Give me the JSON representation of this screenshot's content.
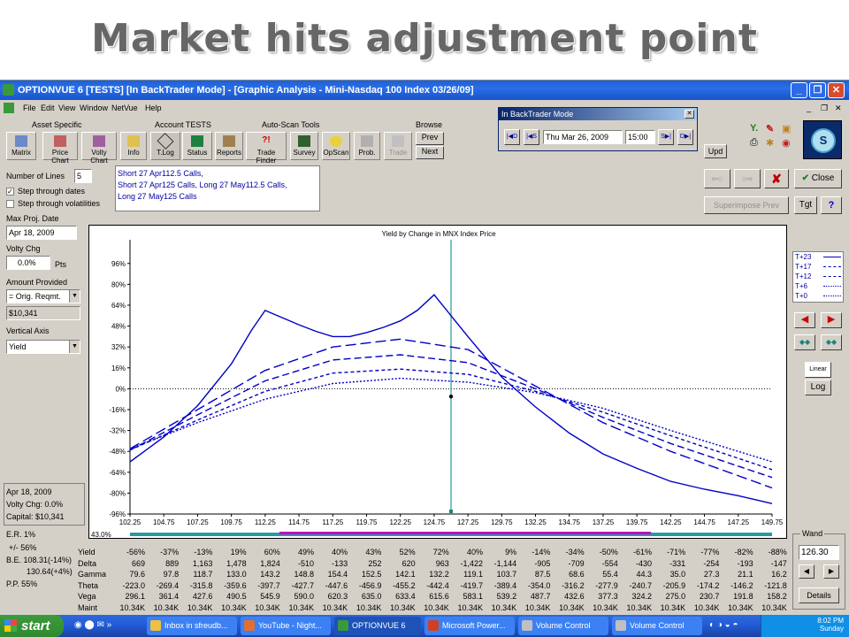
{
  "slide_title": "Market hits adjustment point",
  "window": {
    "title": "OPTIONVUE 6   [TESTS]  [In BackTrader Mode] - [Graphic Analysis - Mini-Nasdaq 100 Index  03/26/09]"
  },
  "menu": [
    "File",
    "Edit",
    "View",
    "Window",
    "NetVue",
    "Help"
  ],
  "groups": {
    "asset_specific": "Asset Specific",
    "account": "Account TESTS",
    "autoscan": "Auto-Scan Tools",
    "browse": "Browse"
  },
  "tools": [
    "Matrix",
    "Price Chart",
    "Volty Chart",
    "Info",
    "T.Log",
    "Status",
    "Reports",
    "Trade Finder",
    "Survey",
    "OpScan",
    "Prob.",
    "Trade"
  ],
  "browse": {
    "prev": "Prev",
    "next": "Next"
  },
  "backtrader": {
    "title": "In BackTrader Mode",
    "date": "Thu Mar 26, 2009",
    "time": "15:00",
    "btn_d_left": "D",
    "btn_s_left": "S",
    "btn_s_right": "S",
    "btn_d_right": "D"
  },
  "upd": "Upd",
  "left_panel": {
    "num_lines_label": "Number of Lines",
    "num_lines": "5",
    "step_dates": "Step through dates",
    "step_vols": "Step through volatilities",
    "max_proj_label": "Max Proj. Date",
    "max_proj": "Apr 18, 2009",
    "volty_label": "Volty Chg",
    "volty": "0.0%",
    "volty_unit": "Pts",
    "amount_label": "Amount Provided",
    "amount_select": "= Orig. Reqmt.",
    "amount_value": "$10,341",
    "vertical_label": "Vertical Axis",
    "vertical_select": "Yield",
    "info_date": "Apr 18, 2009",
    "info_volty": "Volty Chg:  0.0%",
    "info_capital": "Capital:  $10,341"
  },
  "positions": [
    "Short 27 Apr112.5 Calls,",
    "Short 27 Apr125 Calls, Long 27 May112.5 Calls,",
    "Long 27 May125 Calls"
  ],
  "right_buttons": {
    "close": "Close",
    "superimpose": "Superimpose Prev",
    "tgt": "Tgt",
    "help": "?",
    "linear": "Linear",
    "log": "Log"
  },
  "legend": [
    {
      "label": "T+23",
      "style": "solid"
    },
    {
      "label": "T+17",
      "style": "longdash"
    },
    {
      "label": "T+12",
      "style": "dash"
    },
    {
      "label": "T+6",
      "style": "shortdash"
    },
    {
      "label": "T+0",
      "style": "dot"
    }
  ],
  "chart_data": {
    "type": "line",
    "title": "Yield by Change in MNX Index Price",
    "xlabel": "",
    "ylabel": "",
    "x_ticks": [
      "102.25",
      "104.75",
      "107.25",
      "109.75",
      "112.25",
      "114.75",
      "117.25",
      "119.75",
      "122.25",
      "124.75",
      "127.25",
      "129.75",
      "132.25",
      "134.75",
      "137.25",
      "139.75",
      "142.25",
      "144.75",
      "147.25",
      "149.75"
    ],
    "y_ticks": [
      "96%",
      "80%",
      "64%",
      "48%",
      "32%",
      "16%",
      "0%",
      "-16%",
      "-32%",
      "-48%",
      "-64%",
      "-80%",
      "-96%"
    ],
    "xlim": [
      102.25,
      149.75
    ],
    "ylim": [
      -96,
      106
    ],
    "current_price": 126.0,
    "corner_label": "43.0%",
    "series": [
      {
        "style": "solid",
        "x": [
          102.25,
          104.75,
          107.25,
          109.75,
          111.25,
          112.25,
          114.75,
          116.0,
          117.25,
          118.5,
          119.75,
          121.0,
          122.25,
          123.5,
          124.75,
          127.25,
          129.75,
          132.25,
          134.75,
          137.25,
          139.75,
          142.25,
          144.75,
          147.25,
          149.75
        ],
        "y": [
          -56,
          -37,
          -13,
          19,
          45,
          60,
          49,
          44,
          40,
          40,
          43,
          47,
          52,
          60,
          72,
          40,
          9,
          -14,
          -34,
          -50,
          -61,
          -71,
          -77,
          -82,
          -88
        ]
      },
      {
        "style": "longdash",
        "x": [
          102.25,
          107.25,
          112.25,
          117.25,
          122.25,
          127.25,
          132.25,
          137.25,
          142.25,
          149.75
        ],
        "y": [
          -46,
          -16,
          14,
          32,
          38,
          30,
          2,
          -26,
          -48,
          -76
        ]
      },
      {
        "style": "dash",
        "x": [
          102.25,
          107.25,
          112.25,
          117.25,
          122.25,
          127.25,
          132.25,
          137.25,
          142.25,
          149.75
        ],
        "y": [
          -47,
          -20,
          6,
          22,
          26,
          20,
          0,
          -22,
          -42,
          -68
        ]
      },
      {
        "style": "shortdash",
        "x": [
          102.25,
          107.25,
          112.25,
          117.25,
          122.25,
          127.25,
          132.25,
          137.25,
          142.25,
          149.75
        ],
        "y": [
          -47,
          -24,
          -2,
          12,
          15,
          11,
          -2,
          -18,
          -36,
          -62
        ]
      },
      {
        "style": "dot",
        "x": [
          102.25,
          107.25,
          112.25,
          117.25,
          122.25,
          127.25,
          132.25,
          137.25,
          142.25,
          149.75
        ],
        "y": [
          -46,
          -26,
          -8,
          4,
          8,
          5,
          -3,
          -15,
          -32,
          -56
        ]
      }
    ]
  },
  "table": {
    "pm_label": "+/-   56%",
    "be_label": "B.E.  108.31(-14%)",
    "be2_label": "130.64(+4%)",
    "pp_label": "P.P.  55%",
    "er_label": "E.R.    1%",
    "row_labels": [
      "Yield",
      "Delta",
      "Gamma",
      "Theta",
      "Vega",
      "Maint"
    ],
    "columns": [
      [
        "-56%",
        "669",
        "79.6",
        "-223.0",
        "296.1",
        "10.34K"
      ],
      [
        "-37%",
        "889",
        "97.8",
        "-269.4",
        "361.4",
        "10.34K"
      ],
      [
        "-13%",
        "1,163",
        "118.7",
        "-315.8",
        "427.6",
        "10.34K"
      ],
      [
        "19%",
        "1,478",
        "133.0",
        "-359.6",
        "490.5",
        "10.34K"
      ],
      [
        "60%",
        "1,824",
        "143.2",
        "-397.7",
        "545.9",
        "10.34K"
      ],
      [
        "49%",
        "-510",
        "148.8",
        "-427.7",
        "590.0",
        "10.34K"
      ],
      [
        "40%",
        "-133",
        "154.4",
        "-447.6",
        "620.3",
        "10.34K"
      ],
      [
        "43%",
        "252",
        "152.5",
        "-456.9",
        "635.0",
        "10.34K"
      ],
      [
        "52%",
        "620",
        "142.1",
        "-455.2",
        "633.4",
        "10.34K"
      ],
      [
        "72%",
        "963",
        "132.2",
        "-442.4",
        "615.6",
        "10.34K"
      ],
      [
        "40%",
        "-1,422",
        "119.1",
        "-419.7",
        "583.1",
        "10.34K"
      ],
      [
        "9%",
        "-1,144",
        "103.7",
        "-389.4",
        "539.2",
        "10.34K"
      ],
      [
        "-14%",
        "-905",
        "87.5",
        "-354.0",
        "487.7",
        "10.34K"
      ],
      [
        "-34%",
        "-709",
        "68.6",
        "-316.2",
        "432.6",
        "10.34K"
      ],
      [
        "-50%",
        "-554",
        "55.4",
        "-277.9",
        "377.3",
        "10.34K"
      ],
      [
        "-61%",
        "-430",
        "44.3",
        "-240.7",
        "324.2",
        "10.34K"
      ],
      [
        "-71%",
        "-331",
        "35.0",
        "-205.9",
        "275.0",
        "10.34K"
      ],
      [
        "-77%",
        "-254",
        "27.3",
        "-174.2",
        "230.7",
        "10.34K"
      ],
      [
        "-82%",
        "-193",
        "21.1",
        "-146.2",
        "191.8",
        "10.34K"
      ],
      [
        "-88%",
        "-147",
        "16.2",
        "-121.8",
        "158.2",
        "10.34K"
      ]
    ]
  },
  "wand": {
    "label": "Wand",
    "value": "126.30",
    "details": "Details"
  },
  "taskbar": {
    "start": "start",
    "tasks": [
      "Inbox in sfreudb...",
      "YouTube - Night...",
      "OPTIONVUE 6",
      "Microsoft Power...",
      "Volume Control",
      "Volume Control"
    ],
    "time": "8:02 PM",
    "day": "Sunday"
  },
  "colors": {
    "accent": "#0000c8",
    "teal": "#2a9aa0",
    "magenta": "#c000c0",
    "titlebar": "#2a6fe8"
  }
}
